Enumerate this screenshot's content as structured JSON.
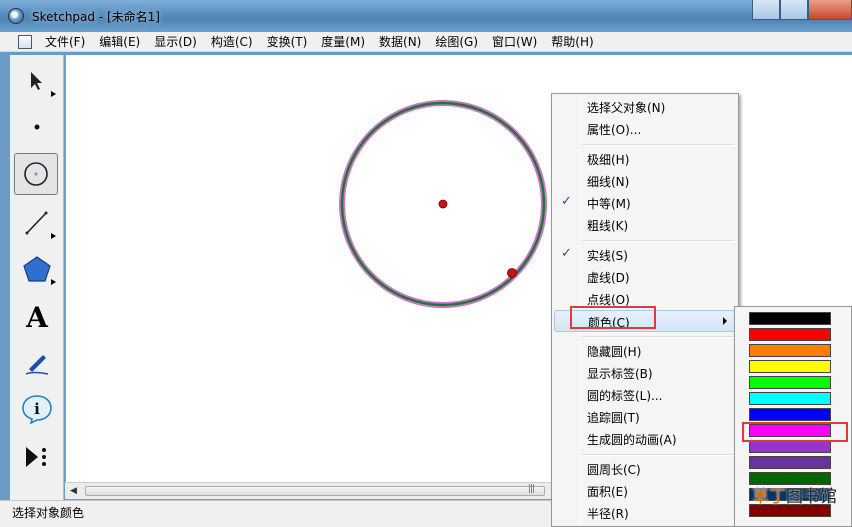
{
  "window": {
    "title": "Sketchpad - [未命名1]"
  },
  "menubar": {
    "items": [
      "文件(F)",
      "编辑(E)",
      "显示(D)",
      "构造(C)",
      "变换(T)",
      "度量(M)",
      "数据(N)",
      "绘图(G)",
      "窗口(W)",
      "帮助(H)"
    ]
  },
  "toolbar": {
    "tools": [
      "arrow-tool",
      "point-tool",
      "compass-tool",
      "line-tool",
      "polygon-tool",
      "text-tool",
      "marker-tool",
      "info-tool",
      "custom-tool"
    ],
    "selected": "compass-tool",
    "text_tool_glyph": "A",
    "info_tool_glyph": "i"
  },
  "context_menu": {
    "items": [
      {
        "label": "选择父对象(N)",
        "checked": false
      },
      {
        "label": "属性(O)...",
        "checked": false
      },
      {
        "label": "极细(H)",
        "checked": false
      },
      {
        "label": "细线(N)",
        "checked": false
      },
      {
        "label": "中等(M)",
        "checked": true
      },
      {
        "label": "粗线(K)",
        "checked": false
      },
      {
        "label": "实线(S)",
        "checked": true
      },
      {
        "label": "虚线(D)",
        "checked": false
      },
      {
        "label": "点线(O)",
        "checked": false
      },
      {
        "label": "颜色(C)",
        "checked": false,
        "submenu": true,
        "highlighted": true
      },
      {
        "label": "隐藏圆(H)",
        "checked": false
      },
      {
        "label": "显示标签(B)",
        "checked": false
      },
      {
        "label": "圆的标签(L)...",
        "checked": false
      },
      {
        "label": "追踪圆(T)",
        "checked": false
      },
      {
        "label": "生成圆的动画(A)",
        "checked": false
      },
      {
        "label": "圆周长(C)",
        "checked": false
      },
      {
        "label": "面积(E)",
        "checked": false
      },
      {
        "label": "半径(R)",
        "checked": false
      }
    ],
    "check_glyph": "✓"
  },
  "color_menu": {
    "swatches": [
      "#000000",
      "#ff0000",
      "#ff8000",
      "#ffff00",
      "#00ff00",
      "#00ffff",
      "#0000ff",
      "#ff00ff",
      "#9933cc",
      "#663399",
      "#006600",
      "#003366",
      "#800000",
      "#c08060"
    ],
    "highlighted_swatch": "#ff00ff"
  },
  "canvas": {
    "circle_color": "#1a7a2a",
    "circle_halo": "#d070d0",
    "point_color": "#cc1111"
  },
  "statusbar": {
    "text": "选择对象颜色"
  },
  "watermark": {
    "part1": "草丁",
    "part2": "图书馆"
  }
}
